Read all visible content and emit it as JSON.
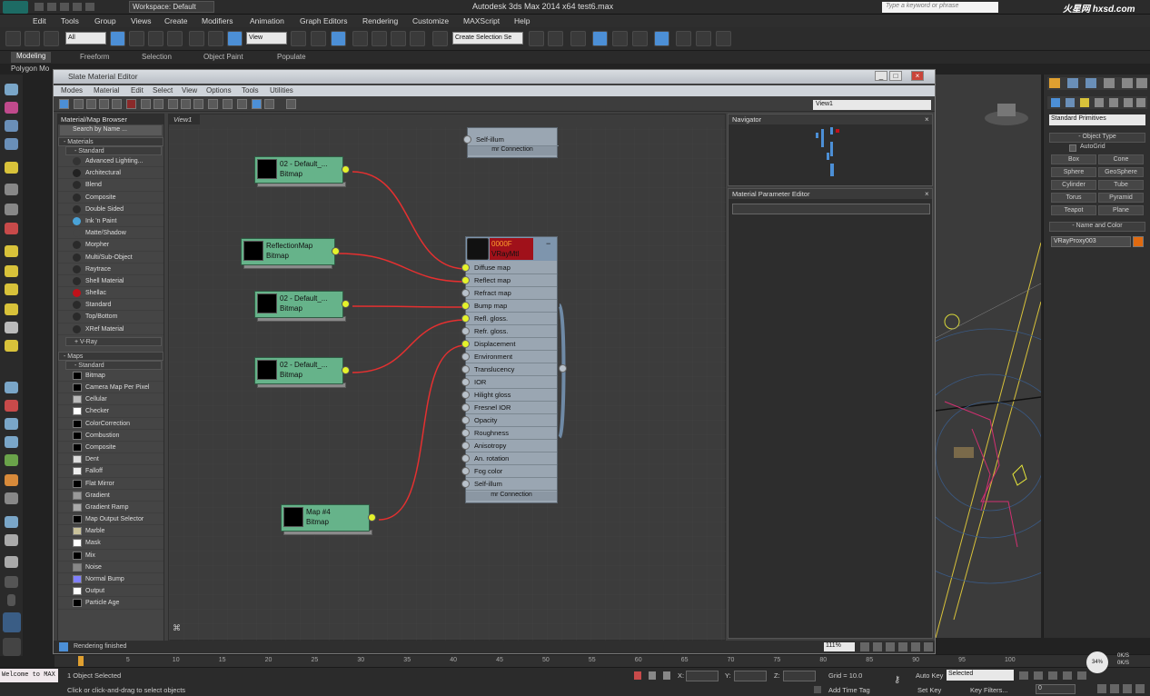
{
  "app": {
    "workspace": "Workspace: Default",
    "title": "Autodesk 3ds Max  2014 x64      test6.max",
    "search_placeholder": "Type a keyword or phrase",
    "brand": "火星网 hxsd.com"
  },
  "menu": [
    "Edit",
    "Tools",
    "Group",
    "Views",
    "Create",
    "Modifiers",
    "Animation",
    "Graph Editors",
    "Rendering",
    "Customize",
    "MAXScript",
    "Help"
  ],
  "toolbar": {
    "filter": "All",
    "view": "View",
    "selection_set": "Create Selection Se"
  },
  "ribbon": {
    "tabs": [
      "Modeling",
      "Freeform",
      "Selection",
      "Object Paint",
      "Populate"
    ],
    "sub": "Polygon Mo"
  },
  "slate": {
    "title": "Slate Material Editor",
    "menu": [
      "Modes",
      "Material",
      "Edit",
      "Select",
      "View",
      "Options",
      "Tools",
      "Utilities"
    ],
    "view_dropdown": "View1",
    "view_tab": "View1",
    "zoom": "111%",
    "status": "Rendering finished"
  },
  "browser": {
    "title": "Material/Map Browser",
    "search": "Search by Name ...",
    "materials_header": "- Materials",
    "standard_header": "- Standard",
    "materials": [
      {
        "label": "Advanced Lighting...",
        "color": "#333"
      },
      {
        "label": "Architectural",
        "color": "#222"
      },
      {
        "label": "Blend",
        "color": "#2a2a2a"
      },
      {
        "label": "Composite",
        "color": "#2a2a2a"
      },
      {
        "label": "Double Sided",
        "color": "#2a2a2a"
      },
      {
        "label": "Ink 'n Paint",
        "color": "#4aa3d8"
      },
      {
        "label": "Matte/Shadow",
        "color": "#454545"
      },
      {
        "label": "Morpher",
        "color": "#2a2a2a"
      },
      {
        "label": "Multi/Sub-Object",
        "color": "#2a2a2a"
      },
      {
        "label": "Raytrace",
        "color": "#2a2a2a"
      },
      {
        "label": "Shell Material",
        "color": "#2a2a2a"
      },
      {
        "label": "Shellac",
        "color": "#c0111a"
      },
      {
        "label": "Standard",
        "color": "#2a2a2a"
      },
      {
        "label": "Top/Bottom",
        "color": "#2a2a2a"
      },
      {
        "label": "XRef Material",
        "color": "#2a2a2a"
      }
    ],
    "vray_header": "+ V-Ray",
    "maps_header": "- Maps",
    "maps_standard_header": "- Standard",
    "maps": [
      {
        "label": "Bitmap",
        "color": "#000"
      },
      {
        "label": "Camera Map Per Pixel",
        "color": "#000"
      },
      {
        "label": "Cellular",
        "color": "#bbb"
      },
      {
        "label": "Checker",
        "color": "#fff"
      },
      {
        "label": "ColorCorrection",
        "color": "#000"
      },
      {
        "label": "Combustion",
        "color": "#000"
      },
      {
        "label": "Composite",
        "color": "#000"
      },
      {
        "label": "Dent",
        "color": "#ddd"
      },
      {
        "label": "Falloff",
        "color": "#eee"
      },
      {
        "label": "Flat Mirror",
        "color": "#000"
      },
      {
        "label": "Gradient",
        "color": "#999"
      },
      {
        "label": "Gradient Ramp",
        "color": "#aaa"
      },
      {
        "label": "Map Output Selector",
        "color": "#000"
      },
      {
        "label": "Marble",
        "color": "#c9c29b"
      },
      {
        "label": "Mask",
        "color": "#fff"
      },
      {
        "label": "Mix",
        "color": "#000"
      },
      {
        "label": "Noise",
        "color": "#888"
      },
      {
        "label": "Normal Bump",
        "color": "#8080ff"
      },
      {
        "label": "Output",
        "color": "#fff"
      },
      {
        "label": "Particle Age",
        "color": "#000"
      }
    ]
  },
  "nodes": [
    {
      "title": "02 - Default_...",
      "type": "Bitmap"
    },
    {
      "title": "ReflectionMap",
      "type": "Bitmap"
    },
    {
      "title": "02 - Default_...",
      "type": "Bitmap"
    },
    {
      "title": "02 - Default_...",
      "type": "Bitmap"
    },
    {
      "title": "Map #4",
      "type": "Bitmap"
    }
  ],
  "top_node": {
    "slot": "Self-illum",
    "footer": "mr Connection"
  },
  "material": {
    "name": "0000F",
    "type": "VRayMtl",
    "slots": [
      {
        "label": "Diffuse map",
        "on": true
      },
      {
        "label": "Reflect map",
        "on": true
      },
      {
        "label": "Refract map",
        "on": false
      },
      {
        "label": "Bump map",
        "on": true
      },
      {
        "label": "Refl. gloss.",
        "on": true
      },
      {
        "label": "Refr. gloss.",
        "on": false
      },
      {
        "label": "Displacement",
        "on": true
      },
      {
        "label": "Environment",
        "on": false
      },
      {
        "label": "Translucency",
        "on": false
      },
      {
        "label": "IOR",
        "on": false
      },
      {
        "label": "Hilight gloss",
        "on": false
      },
      {
        "label": "Fresnel IOR",
        "on": false
      },
      {
        "label": "Opacity",
        "on": false
      },
      {
        "label": "Roughness",
        "on": false
      },
      {
        "label": "Anisotropy",
        "on": false
      },
      {
        "label": "An. rotation",
        "on": false
      },
      {
        "label": "Fog color",
        "on": false
      },
      {
        "label": "Self-illum",
        "on": false
      }
    ],
    "footer": "mr Connection"
  },
  "panels": {
    "navigator": "Navigator",
    "mpe": "Material Parameter Editor"
  },
  "command_panel": {
    "dropdown": "Standard Primitives",
    "object_type": "- Object Type",
    "autogrid": "AutoGrid",
    "buttons": [
      "Box",
      "Cone",
      "Sphere",
      "GeoSphere",
      "Cylinder",
      "Tube",
      "Torus",
      "Pyramid",
      "Teapot",
      "Plane"
    ],
    "name_color": "- Name and Color",
    "object_name": "VRayProxy003",
    "object_color": "#e06a10"
  },
  "timeline": {
    "ticks": [
      "0",
      "5",
      "10",
      "15",
      "20",
      "25",
      "30",
      "35",
      "40",
      "45",
      "50",
      "55",
      "60",
      "65",
      "70",
      "75",
      "80",
      "85",
      "90",
      "95",
      "100"
    ]
  },
  "statusbar": {
    "listener": "Welcome to MAX",
    "selected": "1 Object Selected",
    "prompt": "Click or click-and-drag to select objects",
    "x_label": "X:",
    "y_label": "Y:",
    "z_label": "Z:",
    "grid": "Grid = 10.0",
    "autokey": "Auto Key",
    "autokey_mode": "Selected",
    "setkey": "Set Key",
    "keyfilters": "Key Filters...",
    "add_time_tag": "Add Time Tag",
    "frame": "0",
    "perf": "34%",
    "rates": [
      "0K/S",
      "0K/S"
    ]
  }
}
